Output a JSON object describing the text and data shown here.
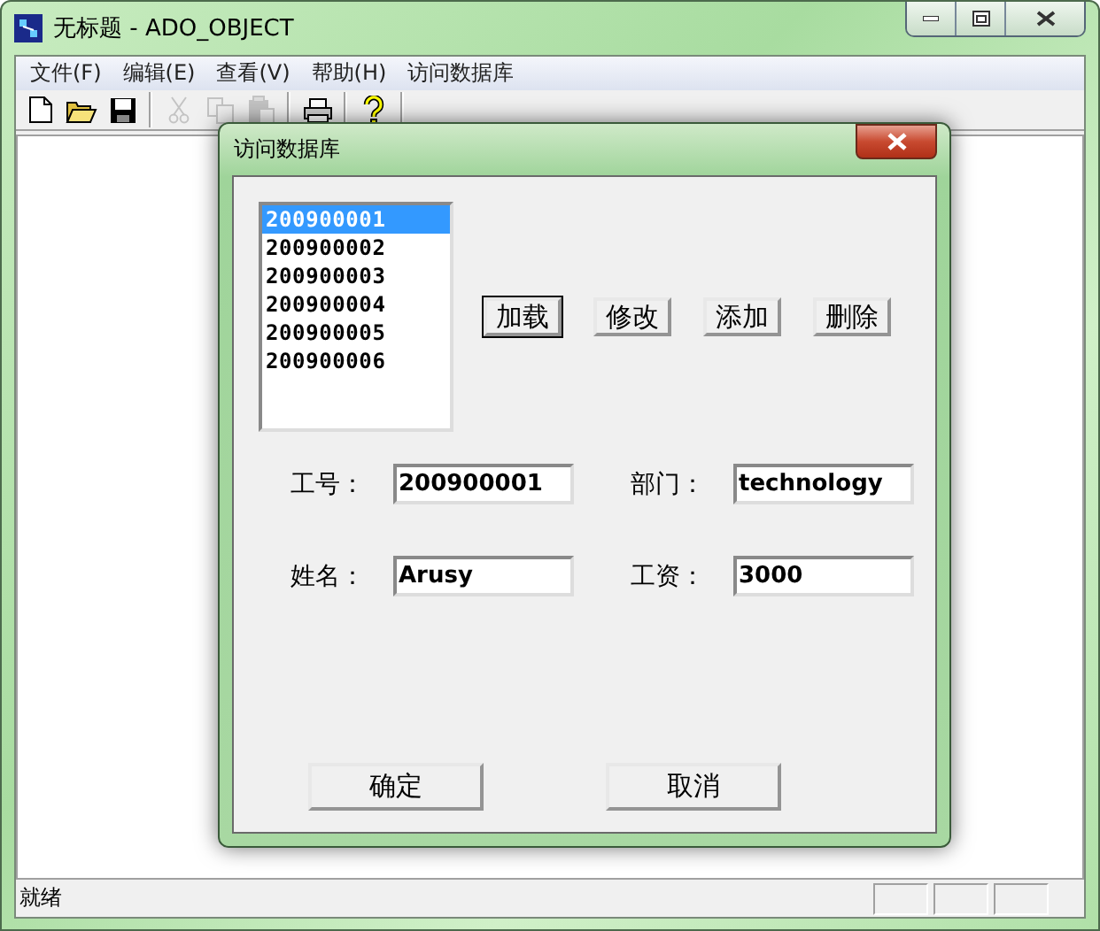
{
  "window": {
    "title": "无标题 - ADO_OBJECT"
  },
  "menu": [
    "文件(F)",
    "编辑(E)",
    "查看(V)",
    "帮助(H)",
    "访问数据库"
  ],
  "toolbar": [
    {
      "kind": "new",
      "disabled": false
    },
    {
      "kind": "open",
      "disabled": false
    },
    {
      "kind": "save",
      "disabled": false
    },
    {
      "kind": "separator"
    },
    {
      "kind": "cut",
      "disabled": true
    },
    {
      "kind": "copy",
      "disabled": true
    },
    {
      "kind": "paste",
      "disabled": true
    },
    {
      "kind": "separator"
    },
    {
      "kind": "print",
      "disabled": false
    },
    {
      "kind": "separator"
    },
    {
      "kind": "help",
      "disabled": false
    },
    {
      "kind": "separator"
    }
  ],
  "dialog": {
    "title": "访问数据库",
    "list": [
      {
        "label": "200900001",
        "selected": true
      },
      {
        "label": "200900002",
        "selected": false
      },
      {
        "label": "200900003",
        "selected": false
      },
      {
        "label": "200900004",
        "selected": false
      },
      {
        "label": "200900005",
        "selected": false
      },
      {
        "label": "200900006",
        "selected": false
      }
    ],
    "actions": [
      {
        "label": "加载",
        "focused": true
      },
      {
        "label": "修改",
        "focused": false
      },
      {
        "label": "添加",
        "focused": false
      },
      {
        "label": "删除",
        "focused": false
      }
    ],
    "fields": [
      {
        "label": "工号：",
        "value": "200900001"
      },
      {
        "label": "部门：",
        "value": "technology"
      },
      {
        "label": "姓名：",
        "value": "Arusy"
      },
      {
        "label": "工资：",
        "value": "3000"
      }
    ],
    "buttons": [
      "确定",
      "取消"
    ]
  },
  "status_bar": {
    "text": "就绪"
  }
}
